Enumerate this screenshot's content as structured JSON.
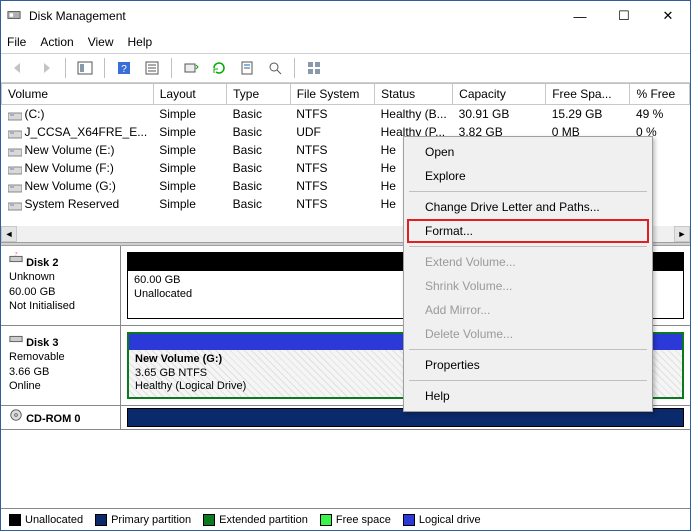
{
  "window": {
    "title": "Disk Management"
  },
  "menu": {
    "file": "File",
    "action": "Action",
    "view": "View",
    "help": "Help"
  },
  "table": {
    "headers": {
      "volume": "Volume",
      "layout": "Layout",
      "type": "Type",
      "fs": "File System",
      "status": "Status",
      "capacity": "Capacity",
      "free": "Free Spa...",
      "pct": "% Free"
    },
    "rows": [
      {
        "volume": "(C:)",
        "layout": "Simple",
        "type": "Basic",
        "fs": "NTFS",
        "status": "Healthy (B...",
        "capacity": "30.91 GB",
        "free": "15.29 GB",
        "pct": "49 %"
      },
      {
        "volume": "J_CCSA_X64FRE_E...",
        "layout": "Simple",
        "type": "Basic",
        "fs": "UDF",
        "status": "Healthy (P...",
        "capacity": "3.82 GB",
        "free": "0 MB",
        "pct": "0 %"
      },
      {
        "volume": "New Volume (E:)",
        "layout": "Simple",
        "type": "Basic",
        "fs": "NTFS",
        "status": "He",
        "capacity": "",
        "free": "",
        "pct": ""
      },
      {
        "volume": "New Volume (F:)",
        "layout": "Simple",
        "type": "Basic",
        "fs": "NTFS",
        "status": "He",
        "capacity": "",
        "free": "",
        "pct": ""
      },
      {
        "volume": "New Volume (G:)",
        "layout": "Simple",
        "type": "Basic",
        "fs": "NTFS",
        "status": "He",
        "capacity": "",
        "free": "",
        "pct": ""
      },
      {
        "volume": "System Reserved",
        "layout": "Simple",
        "type": "Basic",
        "fs": "NTFS",
        "status": "He",
        "capacity": "",
        "free": "",
        "pct": ""
      }
    ]
  },
  "context_menu": {
    "open": "Open",
    "explore": "Explore",
    "change": "Change Drive Letter and Paths...",
    "format": "Format...",
    "extend": "Extend Volume...",
    "shrink": "Shrink Volume...",
    "mirror": "Add Mirror...",
    "delete": "Delete Volume...",
    "props": "Properties",
    "help": "Help"
  },
  "disks": {
    "d2": {
      "name": "Disk 2",
      "state": "Unknown",
      "size": "60.00 GB",
      "init": "Not Initialised",
      "part_size": "60.00 GB",
      "part_state": "Unallocated"
    },
    "d3": {
      "name": "Disk 3",
      "state": "Removable",
      "size": "3.66 GB",
      "init": "Online",
      "vol_name": "New Volume  (G:)",
      "vol_size": "3.65 GB NTFS",
      "vol_state": "Healthy (Logical Drive)"
    },
    "cd": {
      "name": "CD-ROM 0"
    }
  },
  "legend": {
    "unalloc": "Unallocated",
    "primary": "Primary partition",
    "extended": "Extended partition",
    "free": "Free space",
    "logical": "Logical drive",
    "colors": {
      "unalloc": "#000000",
      "primary": "#0b2a6b",
      "extended": "#0b7a1e",
      "free": "#38f54a",
      "logical": "#2a39d8"
    }
  }
}
